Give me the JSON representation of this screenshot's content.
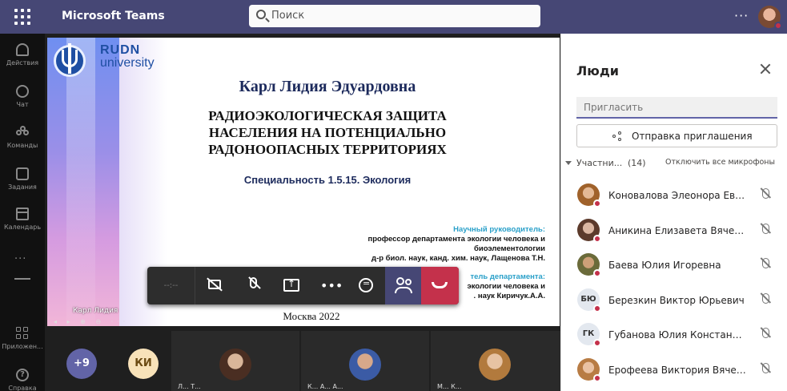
{
  "app": {
    "title": "Microsoft Teams"
  },
  "search": {
    "placeholder": "Поиск"
  },
  "rail": {
    "items": [
      {
        "label": "Действия",
        "icon": "bell-icon"
      },
      {
        "label": "Чат",
        "icon": "chat-icon"
      },
      {
        "label": "Команды",
        "icon": "teams-icon"
      },
      {
        "label": "Задания",
        "icon": "assignments-icon"
      },
      {
        "label": "Календарь",
        "icon": "calendar-icon"
      }
    ],
    "more": "...",
    "apps_label": "Приложен...",
    "help_label": "Справка"
  },
  "slide": {
    "brand_line1": "RUDN",
    "brand_line2": "university",
    "author": "Карл Лидия Эдуардовна",
    "title_lines": [
      "РАДИОЭКОЛОГИЧЕСКАЯ ЗАЩИТА",
      "НАСЕЛЕНИЯ НА ПОТЕНЦИАЛЬНО",
      "РАДОНООПАСНЫХ ТЕРРИТОРИЯХ"
    ],
    "specialty": "Специальность 1.5.15. Экология",
    "supervisor_label": "Научный руководитель:",
    "supervisor_lines": [
      "профессор департамента экологии человека и",
      "биоэлементологии",
      "д-р биол. наук, канд. хим. наук, Лащенова Т.Н."
    ],
    "head_label": "тель департамента:",
    "head_lines": [
      "экологии человека и",
      ". наук Киричук.А.А."
    ],
    "city_year": "Москва 2022",
    "presenter": "Карл Лидия"
  },
  "controls": {
    "timer": "--:--"
  },
  "tiles": [
    {
      "type": "overflow",
      "text": "+9",
      "color": "#6264a7"
    },
    {
      "type": "initials",
      "text": "КИ",
      "color": "#f8e2b9"
    },
    {
      "type": "photo",
      "name": "Л... Т...",
      "skin": "#d9b69a",
      "hair": "#4a2e22"
    },
    {
      "type": "photo",
      "name": "К... А... А...",
      "skin": "#d7a88a",
      "hair": "#3b5ba5"
    },
    {
      "type": "photo",
      "name": "М... К...",
      "skin": "#e7c3a3",
      "hair": "#b27a3d"
    }
  ],
  "people_pane": {
    "title": "Люди",
    "invite_placeholder": "Пригласить",
    "share_invite_label": "Отправка приглашения",
    "section_label": "Участни...",
    "participant_count": "(14)",
    "mute_all_label": "Отключить все микрофоны",
    "participants": [
      {
        "name": "Коновалова Элеонора Евге...",
        "initials": "",
        "skin": "#e4b995",
        "hair": "#a0622b"
      },
      {
        "name": "Аникина Елизавета Вячесл...",
        "initials": "",
        "skin": "#dbb6a1",
        "hair": "#5c3a2b"
      },
      {
        "name": "Баева Юлия Игоревна",
        "initials": "",
        "skin": "#cda078",
        "hair": "#6b6b3a"
      },
      {
        "name": "Березкин Виктор Юрьевич",
        "initials": "БЮ",
        "skin": "",
        "hair": ""
      },
      {
        "name": "Губанова Юлия Константи...",
        "initials": "ГК",
        "skin": "",
        "hair": ""
      },
      {
        "name": "Ерофеева Виктория Вячесл...",
        "initials": "",
        "skin": "#eac2a3",
        "hair": "#b87c44"
      }
    ]
  }
}
